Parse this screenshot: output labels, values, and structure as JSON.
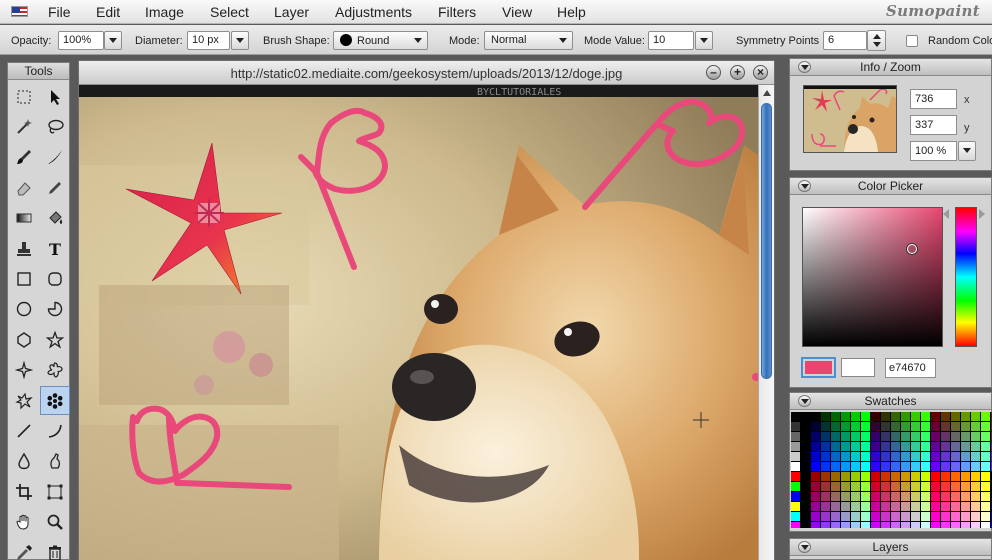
{
  "menubar": {
    "items": [
      "File",
      "Edit",
      "Image",
      "Select",
      "Layer",
      "Adjustments",
      "Filters",
      "View",
      "Help"
    ],
    "brand": "Sumopaint"
  },
  "options": {
    "opacity_label": "Opacity:",
    "opacity_value": "100%",
    "diameter_label": "Diameter:",
    "diameter_value": "10 px",
    "shape_label": "Brush Shape:",
    "shape_value": "Round",
    "mode_label": "Mode:",
    "mode_value": "Normal",
    "mode_value_label": "Mode Value:",
    "mode_value_value": "10",
    "symmetry_label": "Symmetry Points",
    "symmetry_value": "6",
    "random_label": "Random Colo"
  },
  "tools": {
    "title": "Tools",
    "items": [
      {
        "name": "marquee-tool",
        "glyph": ""
      },
      {
        "name": "move-tool",
        "glyph": ""
      },
      {
        "name": "magic-wand-tool",
        "glyph": ""
      },
      {
        "name": "lasso-tool",
        "glyph": ""
      },
      {
        "name": "brush-tool",
        "glyph": ""
      },
      {
        "name": "calligraphy-tool",
        "glyph": ""
      },
      {
        "name": "eraser-tool",
        "glyph": ""
      },
      {
        "name": "pencil-tool",
        "glyph": ""
      },
      {
        "name": "gradient-tool",
        "glyph": ""
      },
      {
        "name": "fill-tool",
        "glyph": ""
      },
      {
        "name": "stamp-tool",
        "glyph": ""
      },
      {
        "name": "text-tool",
        "glyph": "T"
      },
      {
        "name": "rectangle-tool",
        "glyph": ""
      },
      {
        "name": "rounded-rectangle-tool",
        "glyph": ""
      },
      {
        "name": "ellipse-tool",
        "glyph": ""
      },
      {
        "name": "pie-tool",
        "glyph": ""
      },
      {
        "name": "polygon-tool",
        "glyph": ""
      },
      {
        "name": "star-tool",
        "glyph": ""
      },
      {
        "name": "star-outline-tool",
        "glyph": ""
      },
      {
        "name": "flower-shape-tool",
        "glyph": ""
      },
      {
        "name": "blob-shape-tool",
        "glyph": ""
      },
      {
        "name": "symmetry-tool",
        "glyph": ""
      },
      {
        "name": "line-tool",
        "glyph": ""
      },
      {
        "name": "curve-tool",
        "glyph": ""
      },
      {
        "name": "blur-tool",
        "glyph": ""
      },
      {
        "name": "smudge-tool",
        "glyph": ""
      },
      {
        "name": "crop-tool",
        "glyph": ""
      },
      {
        "name": "transform-tool",
        "glyph": ""
      },
      {
        "name": "hand-tool",
        "glyph": ""
      },
      {
        "name": "zoom-tool",
        "glyph": ""
      },
      {
        "name": "eyedropper-tool",
        "glyph": ""
      },
      {
        "name": "trash-tool",
        "glyph": ""
      }
    ],
    "active": "symmetry-tool"
  },
  "document": {
    "title": "http://static02.mediaite.com/geekosystem/uploads/2013/12/doge.jpg",
    "watermark": "BYCLTUTORIALES",
    "buttons": [
      "minimize-icon",
      "maximize-icon",
      "close-icon"
    ],
    "stroke_color": "#e8497a"
  },
  "info": {
    "title": "Info / Zoom",
    "x_value": "736",
    "x_label": "x",
    "y_value": "337",
    "y_label": "y",
    "zoom_value": "100 %"
  },
  "color_picker": {
    "title": "Color Picker",
    "hex": "e74670",
    "fg_color": "#e74670",
    "bg_color": "#ffffff"
  },
  "swatches": {
    "title": "Swatches"
  },
  "layers": {
    "title": "Layers"
  }
}
